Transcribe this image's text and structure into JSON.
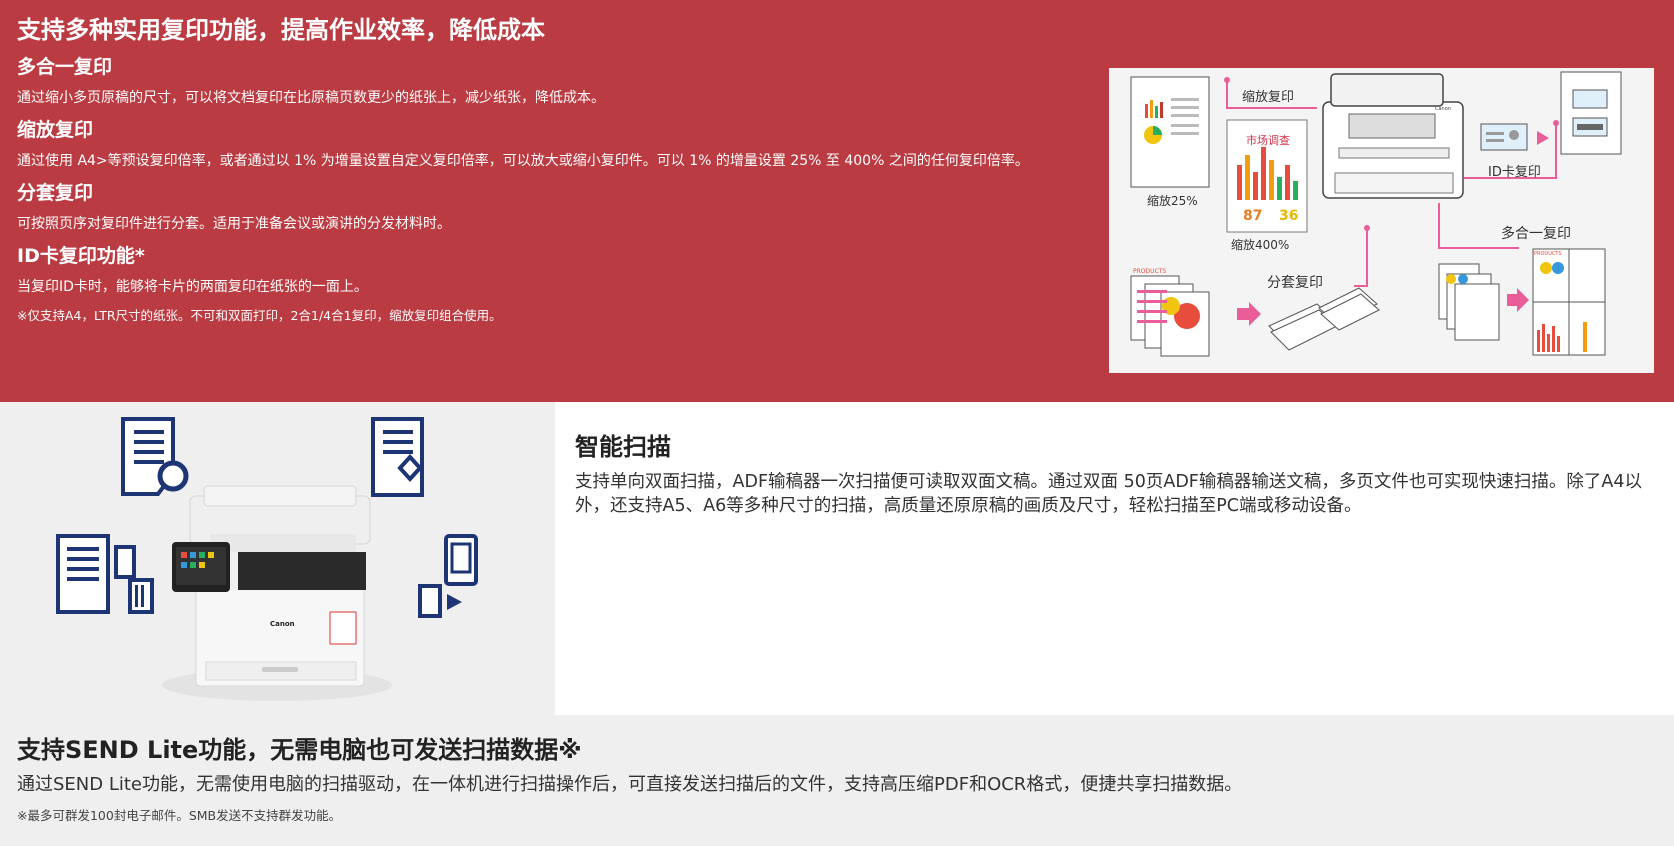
{
  "copy": {
    "title": "支持多种实用复印功能，提高作业效率，降低成本",
    "features": [
      {
        "title": "多合一复印",
        "desc": "通过缩小多页原稿的尺寸，可以将文档复印在比原稿页数更少的纸张上，减少纸张，降低成本。"
      },
      {
        "title": "缩放复印",
        "desc": "通过使用 A4>等预设复印倍率，或者通过以 1% 为增量设置自定义复印倍率，可以放大或缩小复印件。可以 1% 的增量设置 25% 至 400% 之间的任何复印倍率。"
      },
      {
        "title": "分套复印",
        "desc": "可按照页序对复印件进行分套。适用于准备会议或演讲的分发材料时。"
      },
      {
        "title": "ID卡复印功能*",
        "desc": "当复印ID卡时，能够将卡片的两面复印在纸张的一面上。"
      }
    ],
    "note": "※仅支持A4，LTR尺寸的纸张。不可和双面打印，2合1/4合1复印，缩放复印组合使用。",
    "diagram": {
      "reduce_label": "缩放复印",
      "reduce_25": "缩放25%",
      "market_label": "市场调查",
      "pct_a": "87",
      "pct_b": "36",
      "enlarge_400": "缩放400%",
      "idcard_label": "ID卡复印",
      "nup_label": "多合一复印",
      "collate_label": "分套复印",
      "products_text": "PRODUCTS",
      "printer_brand": "Canon",
      "accent_color": "#e95e98"
    }
  },
  "scan": {
    "title": "智能扫描",
    "desc": "支持单向双面扫描，ADF输稿器一次扫描便可读取双面文稿。通过双面 50页ADF输稿器输送文稿，多页文件也可实现快速扫描。除了A4以外，还支持A5、A6等多种尺寸的扫描，高质量还原原稿的画质及尺寸，轻松扫描至PC端或移动设备。",
    "printer_brand": "Canon",
    "icon_color": "#1d3575"
  },
  "send": {
    "title": "支持SEND Lite功能，无需电脑也可发送扫描数据※",
    "desc": "通过SEND Lite功能，无需使用电脑的扫描驱动，在一体机进行扫描操作后，可直接发送扫描后的文件，支持高压缩PDF和OCR格式，便捷共享扫描数据。",
    "note": "※最多可群发100封电子邮件。SMB发送不支持群发功能。"
  }
}
